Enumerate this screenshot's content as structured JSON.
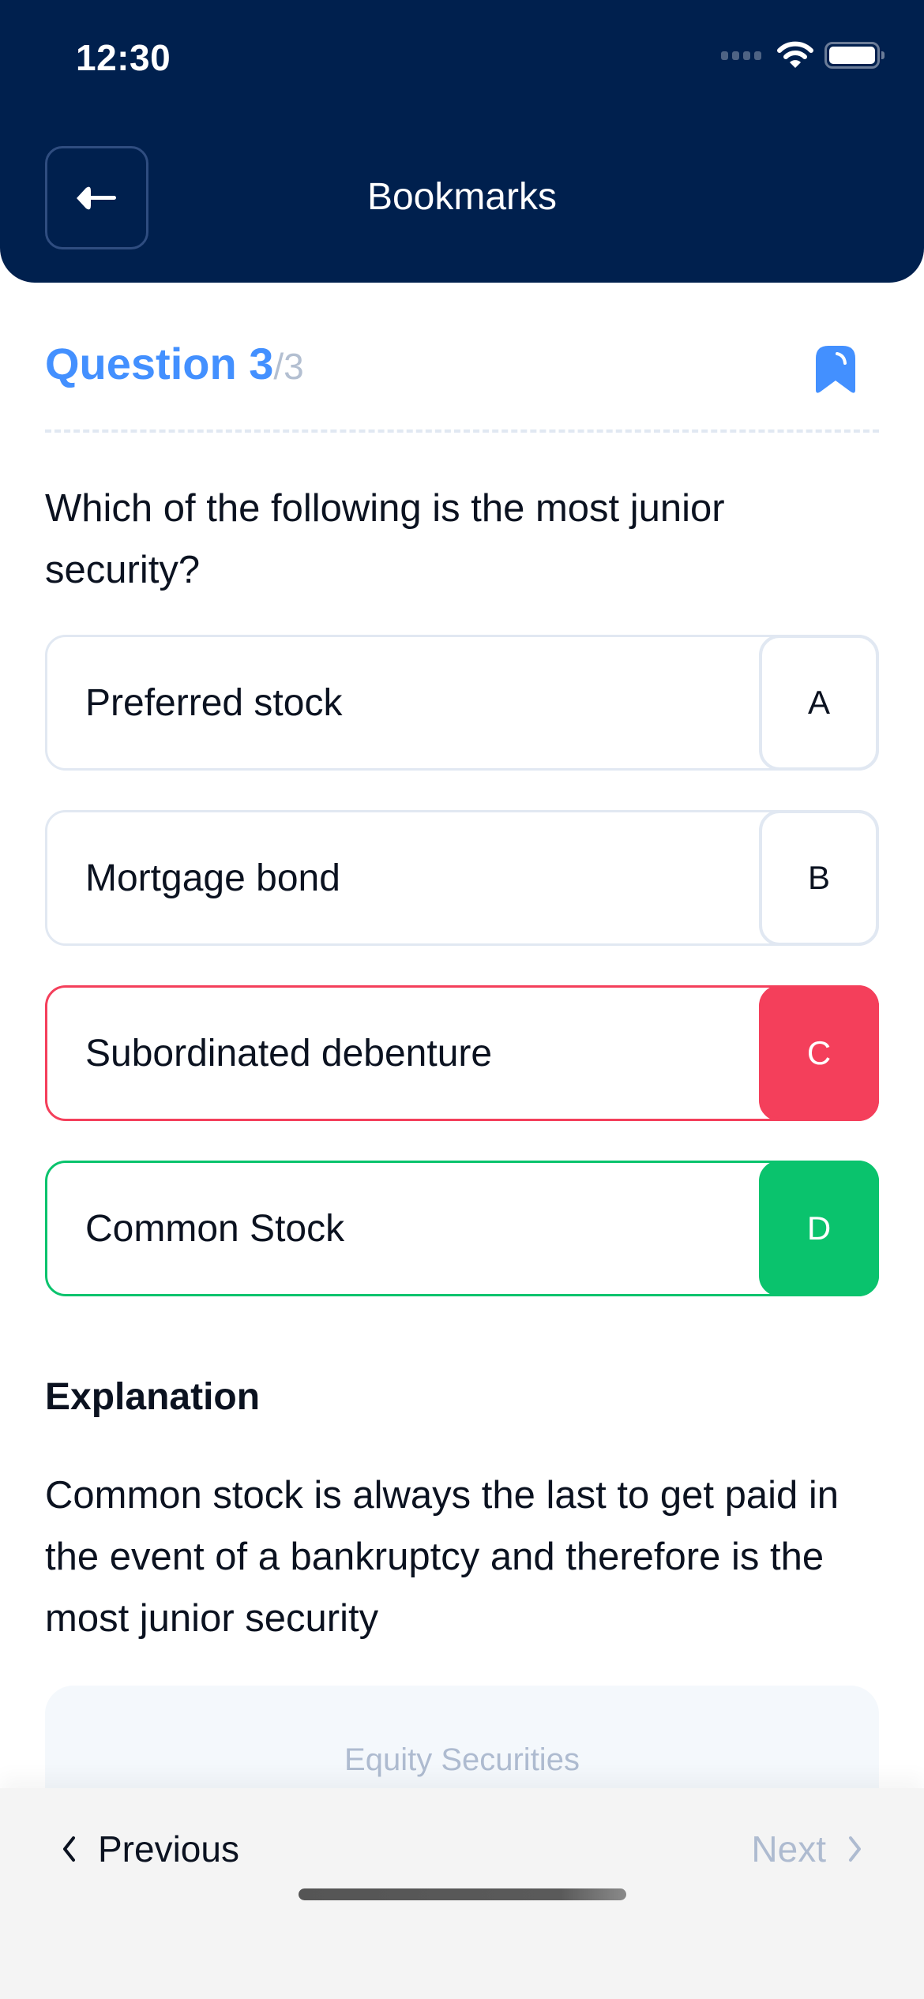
{
  "status_bar": {
    "time": "12:30",
    "icons": [
      "signal-dots-icon",
      "wifi-icon",
      "battery-icon"
    ]
  },
  "header": {
    "title": "Bookmarks",
    "back_icon": "arrow-left-icon",
    "background_color": "#00204e"
  },
  "question": {
    "label": "Question 3",
    "total": "/3",
    "bookmark_icon": "bookmark-filled-icon",
    "accent_color": "#4390ff",
    "text": "Which of the following is the most junior security?"
  },
  "options": [
    {
      "letter": "A",
      "text": "Preferred stock",
      "state": "neutral"
    },
    {
      "letter": "B",
      "text": "Mortgage bond",
      "state": "neutral"
    },
    {
      "letter": "C",
      "text": "Subordinated debenture",
      "state": "wrong"
    },
    {
      "letter": "D",
      "text": "Common Stock",
      "state": "correct"
    }
  ],
  "state_colors": {
    "wrong": "#f43f5b",
    "correct": "#0ac36d",
    "neutral_border": "#e1e8f2"
  },
  "explanation": {
    "title": "Explanation",
    "text": "Common stock is always the last to get paid in the event of a bankruptcy and therefore is the most junior security"
  },
  "topic": {
    "label": "Equity Securities"
  },
  "footer": {
    "previous_label": "Previous",
    "next_label": "Next",
    "previous_icon": "chevron-left-icon",
    "next_icon": "chevron-right-icon"
  }
}
